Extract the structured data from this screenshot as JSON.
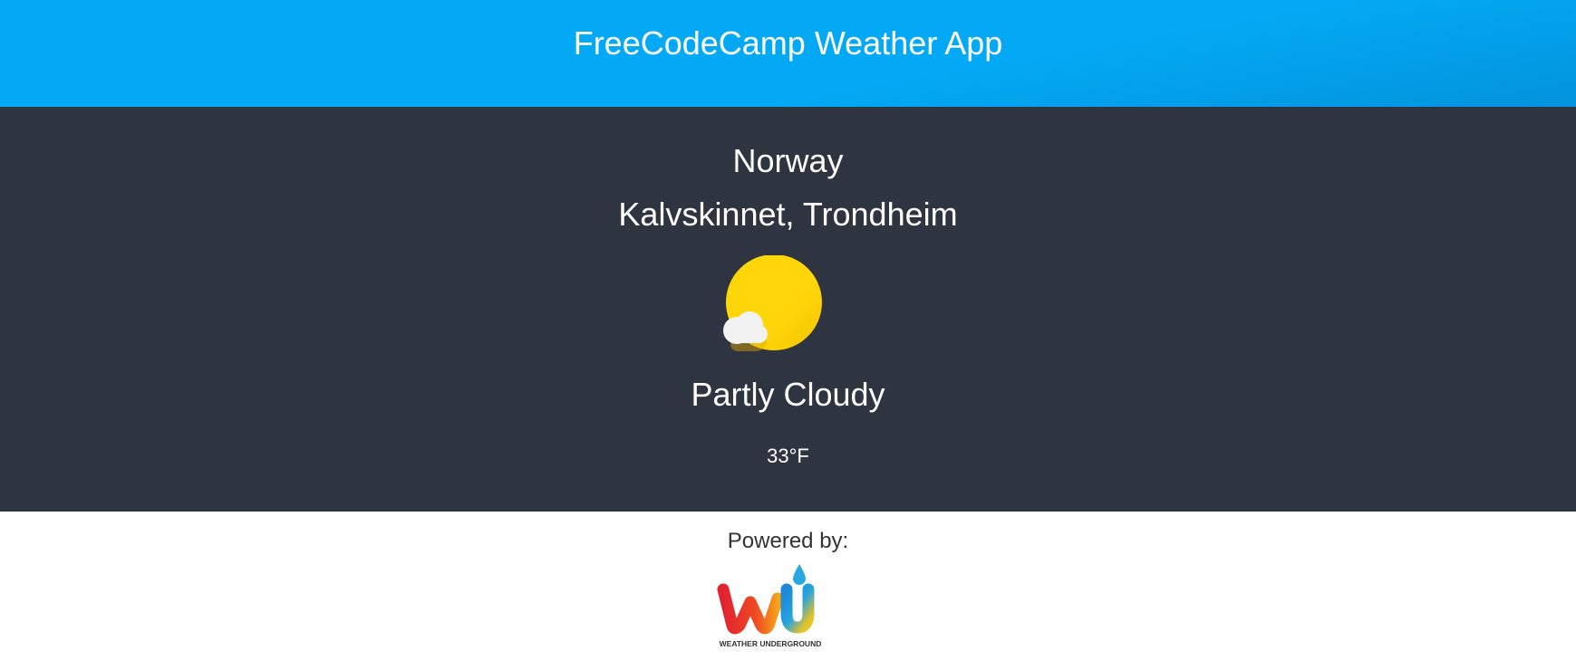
{
  "header": {
    "title": "FreeCodeCamp Weather App"
  },
  "location": {
    "country": "Norway",
    "city": "Kalvskinnet, Trondheim"
  },
  "weather": {
    "icon": "partly-cloudy-icon",
    "condition": "Partly Cloudy",
    "temperature": "33°F"
  },
  "footer": {
    "powered_by": "Powered by:",
    "logo": "weather-underground-logo",
    "logo_text": "WEATHER UNDERGROUND"
  },
  "colors": {
    "header_bg": "#03a9f4",
    "main_bg": "#2f3441",
    "sun": "#ffd60a",
    "cloud": "#f2f2f2"
  }
}
